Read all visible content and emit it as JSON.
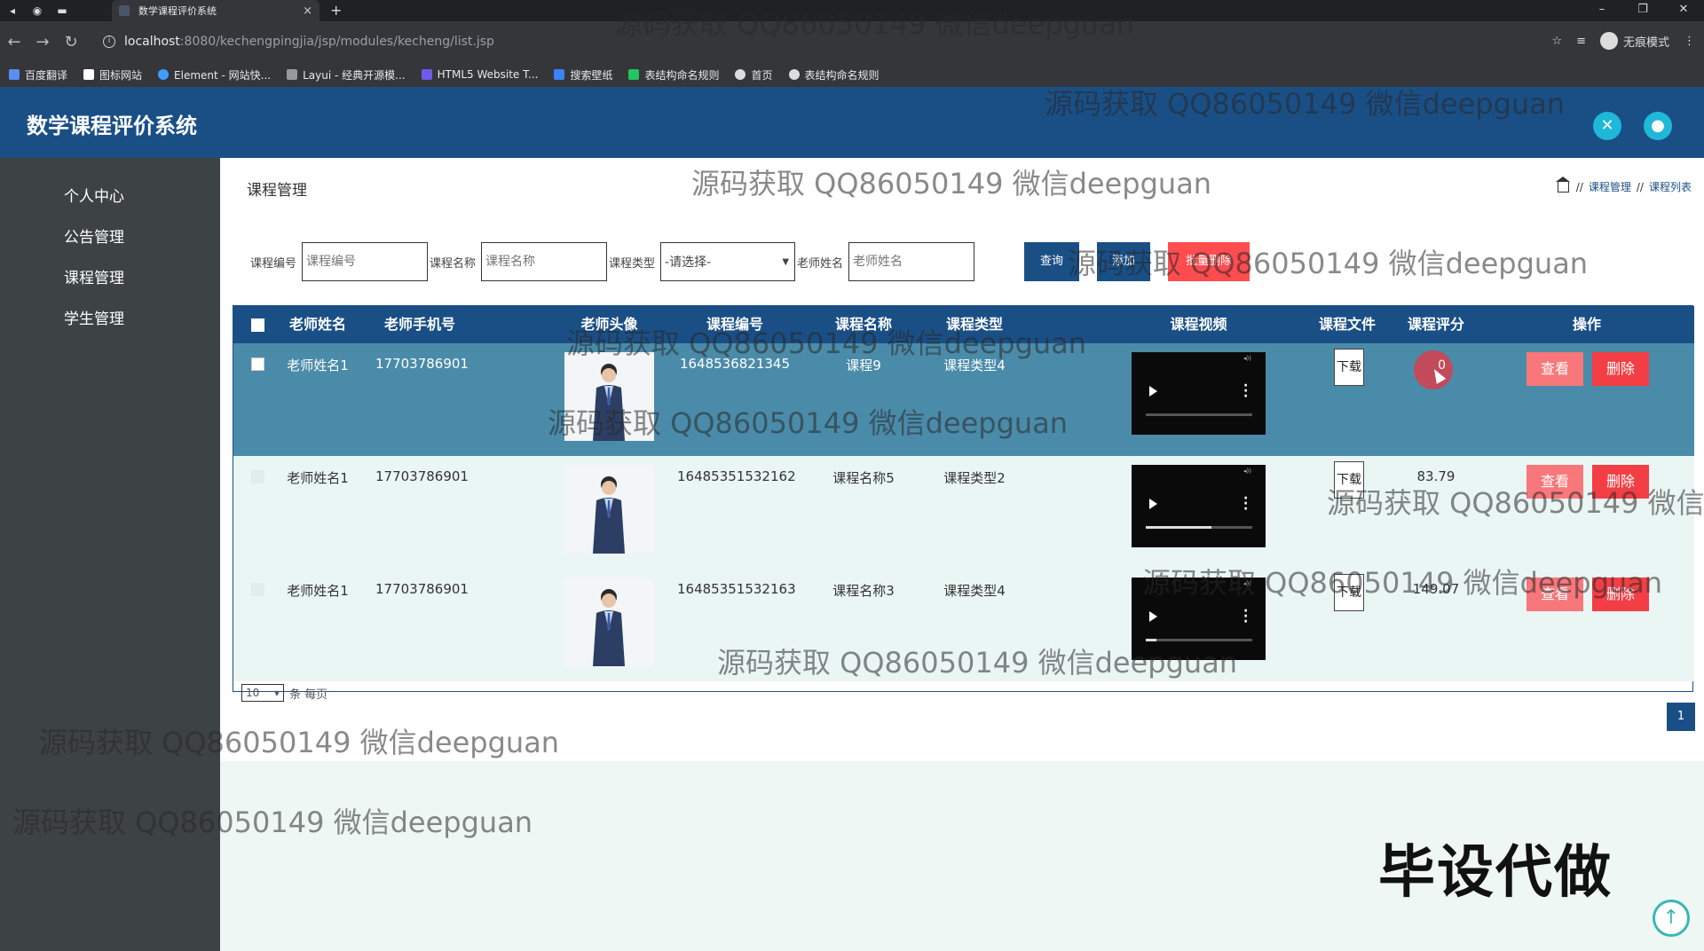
{
  "browser": {
    "tab_title": "数学课程评价系统",
    "tab_close": "×",
    "new_tab": "+",
    "url_host": "localhost",
    "url_path": ":8080/kechengpingjia/jsp/modules/kecheng/list.jsp",
    "incognito_label": "无痕模式",
    "window_controls": [
      "–",
      "❐",
      "✕"
    ],
    "bookmarks": [
      "百度翻译",
      "图标网站",
      "Element - 网站快...",
      "Layui - 经典开源模...",
      "HTML5 Website T...",
      "搜索壁纸",
      "表结构命名规则",
      "首页",
      "表结构命名规则"
    ]
  },
  "app": {
    "title": "数学课程评价系统"
  },
  "sidebar": {
    "items": [
      "个人中心",
      "公告管理",
      "课程管理",
      "学生管理"
    ]
  },
  "page": {
    "title": "课程管理",
    "breadcrumb": [
      "课程管理",
      "课程列表"
    ],
    "breadcrumb_sep": "//"
  },
  "search": {
    "label_code": "课程编号",
    "placeholder_code": "课程编号",
    "label_name": "课程名称",
    "placeholder_name": "课程名称",
    "label_type": "课程类型",
    "select_value": "-请选择-",
    "label_teacher": "老师姓名",
    "placeholder_teacher": "老师姓名",
    "btn_query": "查询",
    "btn_add": "添加",
    "btn_batch_delete": "批量删除"
  },
  "table": {
    "headers": [
      "老师姓名",
      "老师手机号",
      "老师头像",
      "课程编号",
      "课程名称",
      "课程类型",
      "课程视频",
      "课程文件",
      "课程评分",
      "操作"
    ],
    "download_label": "下载",
    "view_label": "查看",
    "delete_label": "删除",
    "rows": [
      {
        "teacher": "老师姓名1",
        "phone": "17703786901",
        "code": "1648536821345",
        "name": "课程9",
        "type": "课程类型4",
        "score": "0",
        "video_progress": 0.0
      },
      {
        "teacher": "老师姓名1",
        "phone": "17703786901",
        "code": "16485351532162",
        "name": "课程名称5",
        "type": "课程类型2",
        "score": "83.79",
        "video_progress": 0.62
      },
      {
        "teacher": "老师姓名1",
        "phone": "17703786901",
        "code": "16485351532163",
        "name": "课程名称3",
        "type": "课程类型4",
        "score": "149.07",
        "video_progress": 0.1
      }
    ]
  },
  "pager": {
    "page_size": "10",
    "per_page_label": "条 每页",
    "current_page": "1"
  },
  "overlay": {
    "watermark": "源码获取 QQ86050149 微信deepguan",
    "watermark_cut": "源码获取 QQ86050149 微信de",
    "promo": "毕设代做"
  },
  "colors": {
    "primary": "#1a4f86",
    "danger": "#f23e44",
    "sidebar": "#3d4244",
    "accent": "#1fb8d8"
  }
}
